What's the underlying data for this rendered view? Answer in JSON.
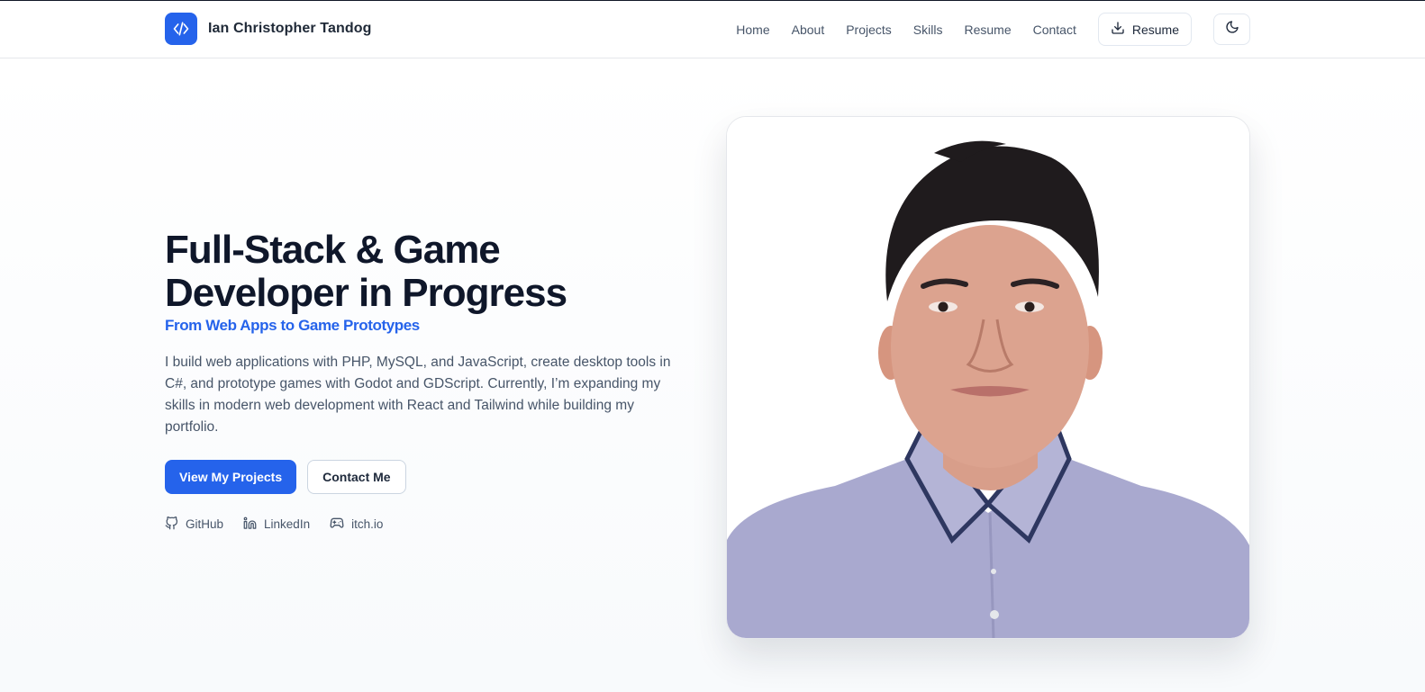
{
  "brand": {
    "name": "Ian Christopher Tandog",
    "logo_icon": "code-icon",
    "logo_color": "#2563eb"
  },
  "nav": {
    "links": [
      "Home",
      "About",
      "Projects",
      "Skills",
      "Resume",
      "Contact"
    ],
    "resume_button": "Resume",
    "resume_icon": "download-icon",
    "theme_icon": "moon-icon"
  },
  "hero": {
    "title_line1": "Full-Stack & Game",
    "title_line2": "Developer in Progress",
    "subtitle": "From Web Apps to Game Prototypes",
    "description": "I build web applications with PHP, MySQL, and JavaScript, create desktop tools in C#, and prototype games with Godot and GDScript. Currently, I’m expanding my skills in modern web development with React and Tailwind while building my portfolio.",
    "primary_cta": "View My Projects",
    "secondary_cta": "Contact Me",
    "socials": [
      {
        "label": "GitHub",
        "icon": "github-icon"
      },
      {
        "label": "LinkedIn",
        "icon": "linkedin-icon"
      },
      {
        "label": "itch.io",
        "icon": "gamepad-icon"
      }
    ]
  },
  "colors": {
    "accent": "#2563eb",
    "heading": "#0f172a",
    "body_text": "#475569"
  }
}
